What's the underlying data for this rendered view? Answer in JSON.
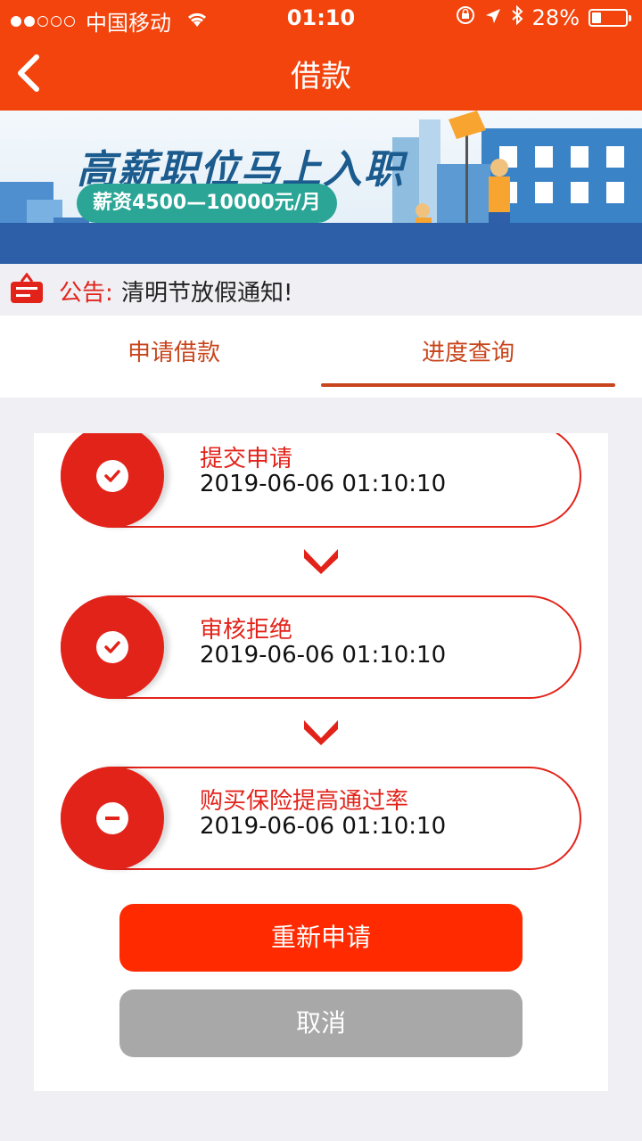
{
  "status_bar": {
    "carrier": "中国移动",
    "time": "01:10",
    "battery": "28%",
    "battery_level": 0.28
  },
  "nav": {
    "title": "借款",
    "back_icon": "chevron-left-icon"
  },
  "banner": {
    "title": "高薪职位马上入职",
    "subtitle": "薪资4500—10000元/月"
  },
  "notice": {
    "label": "公告:",
    "text": "清明节放假通知!"
  },
  "tabs": [
    {
      "label": "申请借款",
      "active": false
    },
    {
      "label": "进度查询",
      "active": true
    }
  ],
  "steps": [
    {
      "title": "提交申请",
      "time": "2019-06-06 01:10:10",
      "icon": "check-circle-icon"
    },
    {
      "title": "审核拒绝",
      "time": "2019-06-06 01:10:10",
      "icon": "check-circle-icon"
    },
    {
      "title": "购买保险提高通过率",
      "time": "2019-06-06 01:10:10",
      "icon": "minus-circle-icon"
    }
  ],
  "buttons": {
    "reapply": "重新申请",
    "cancel": "取消"
  },
  "colors": {
    "brand": "#f2440c",
    "accent_red": "#e2231a",
    "primary_button": "#ff2a00",
    "cancel_button": "#a8a8a8"
  }
}
